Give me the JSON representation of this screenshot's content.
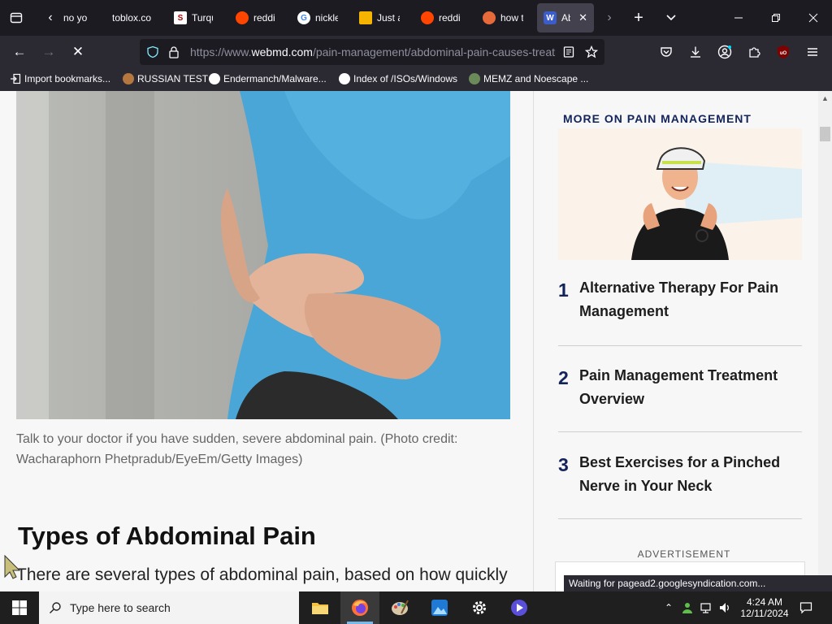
{
  "tabs": [
    {
      "title": "no yo",
      "favicon": "user-icon",
      "color": "#42414d"
    },
    {
      "title": "toblox.co",
      "favicon": "",
      "color": ""
    },
    {
      "title": "Turqu",
      "favicon": "S",
      "color": "#ffffff"
    },
    {
      "title": "reddi",
      "favicon": "reddit-icon",
      "color": "#ff4500"
    },
    {
      "title": "nickle",
      "favicon": "google-icon",
      "color": "#ffffff"
    },
    {
      "title": "Just a",
      "favicon": "cloud-icon",
      "color": "#f4b400"
    },
    {
      "title": "reddi",
      "favicon": "reddit-icon",
      "color": "#ff4500"
    },
    {
      "title": "how t",
      "favicon": "search-icon",
      "color": "#e66a3a"
    },
    {
      "title": "Ab",
      "favicon": "W",
      "color": "#3b5cc9",
      "active": true
    }
  ],
  "nav": {
    "url_prefix": "https://www.",
    "url_domain": "webmd.com",
    "url_path": "/pain-management/abdominal-pain-causes-treatment"
  },
  "bookmarks": [
    {
      "label": "Import bookmarks...",
      "icon": "import-icon"
    },
    {
      "label": "RUSSIAN TEST",
      "icon": "globe-icon"
    },
    {
      "label": "Endermanch/Malware...",
      "icon": "google-icon"
    },
    {
      "label": "Index of /ISOs/Windows",
      "icon": "google-icon"
    },
    {
      "label": "MEMZ and Noescape ...",
      "icon": "page-icon"
    }
  ],
  "article": {
    "caption": "Talk to your doctor if you have sudden, severe abdominal pain. (Photo credit: Wacharaphorn Phetpradub/EyeEm/Getty Images)",
    "section_heading": "Types of Abdominal Pain",
    "body_text": "There are several types of abdominal pain, based on how quickly"
  },
  "sidebar": {
    "heading": "MORE ON PAIN MANAGEMENT",
    "items": [
      {
        "num": "1",
        "title": "Alternative Therapy For Pain Management"
      },
      {
        "num": "2",
        "title": "Pain Management Treatment Overview"
      },
      {
        "num": "3",
        "title": "Best Exercises for a Pinched Nerve in Your Neck"
      }
    ],
    "ad_label": "ADVERTISEMENT"
  },
  "status_text": "Waiting for pagead2.googlesyndication.com...",
  "taskbar": {
    "search_placeholder": "Type here to search",
    "time": "4:24 AM",
    "date": "12/11/2024"
  },
  "colors": {
    "accent_navy": "#13235b",
    "browser_dark": "#1c1b22",
    "toolbar": "#2b2a33"
  }
}
